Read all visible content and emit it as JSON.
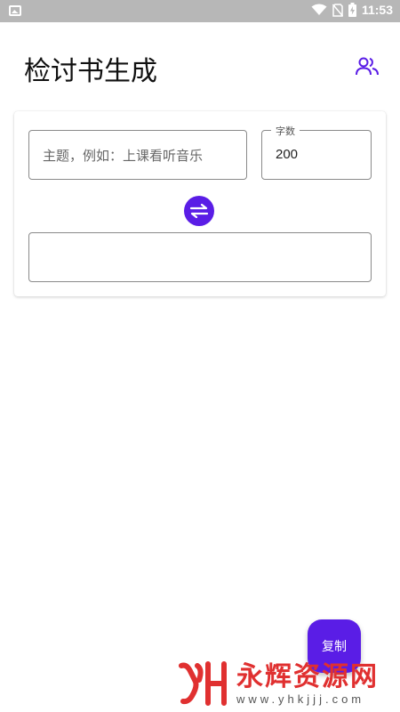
{
  "status_bar": {
    "time": "11:53",
    "left_icon": "image-icon",
    "icons": [
      "wifi-icon",
      "no-sim-icon",
      "battery-charging-icon"
    ]
  },
  "app_bar": {
    "title": "检讨书生成",
    "action_icon": "users-icon"
  },
  "form": {
    "topic_placeholder": "主题，例如：上课看听音乐",
    "count_label": "字数",
    "count_value": "200",
    "swap_icon": "swap-arrows-icon",
    "output_value": ""
  },
  "fab": {
    "label": "复制"
  },
  "watermark": {
    "name": "永辉资源网",
    "url": "www.yhkjjj.com",
    "url_visible": "www.yhkjjj.com"
  },
  "colors": {
    "accent": "#5a1de6",
    "status_bar": "#b7b7b7",
    "watermark_red": "#e03030"
  }
}
